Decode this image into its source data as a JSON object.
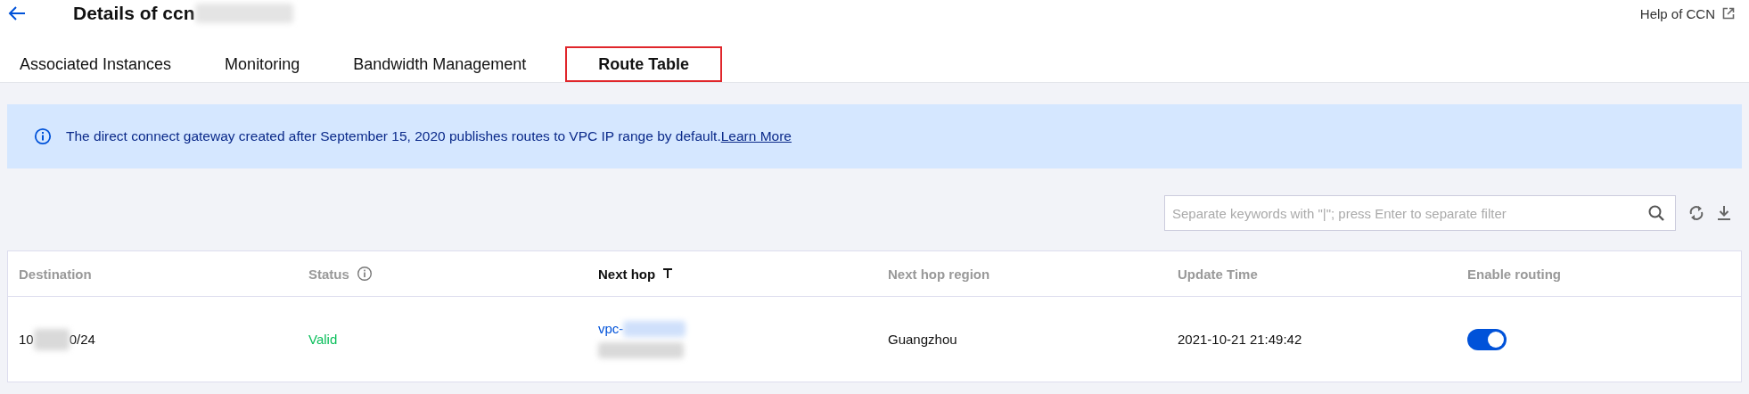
{
  "header": {
    "title": "Details of ccn",
    "help_link": "Help of CCN"
  },
  "tabs": [
    {
      "label": "Associated Instances",
      "selected": false
    },
    {
      "label": "Monitoring",
      "selected": false
    },
    {
      "label": "Bandwidth Management",
      "selected": false
    },
    {
      "label": "Route Table",
      "selected": true
    }
  ],
  "notice": {
    "text": "The direct connect gateway created after September 15, 2020 publishes routes to VPC IP range by default.",
    "link": "Learn More"
  },
  "search": {
    "placeholder": "Separate keywords with \"|\"; press Enter to separate filter"
  },
  "table": {
    "columns": [
      {
        "label": "Destination",
        "kind": "plain"
      },
      {
        "label": "Status",
        "kind": "info"
      },
      {
        "label": "Next hop",
        "kind": "filter"
      },
      {
        "label": "Next hop region",
        "kind": "plain"
      },
      {
        "label": "Update Time",
        "kind": "plain"
      },
      {
        "label": "Enable routing",
        "kind": "plain"
      }
    ],
    "rows": [
      {
        "destination_start": "10",
        "destination_end": "0/24",
        "status": "Valid",
        "next_hop": "vpc-",
        "next_hop_region": "Guangzhou",
        "update_time": "2021-10-21 21:49:42",
        "enable_routing": {
          "on": true
        }
      }
    ]
  }
}
